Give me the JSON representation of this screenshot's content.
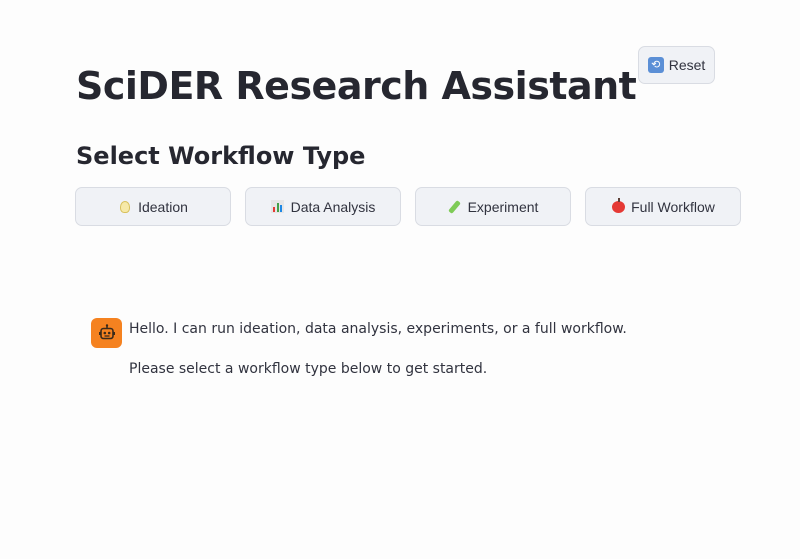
{
  "header": {
    "reset_label": "Reset",
    "reset_icon": "refresh-icon",
    "title": "SciDER Research Assistant"
  },
  "workflow": {
    "section_title": "Select Workflow Type",
    "buttons": [
      {
        "label": "Ideation",
        "icon": "lightbulb-icon"
      },
      {
        "label": "Data Analysis",
        "icon": "bar-chart-icon"
      },
      {
        "label": "Experiment",
        "icon": "test-tube-icon"
      },
      {
        "label": "Full Workflow",
        "icon": "apple-icon"
      }
    ]
  },
  "chat": {
    "avatar_icon": "robot-icon",
    "avatar_color": "#f58220",
    "messages": [
      "Hello. I can run ideation, data analysis, experiments, or a full workflow.",
      "Please select a workflow type below to get started."
    ]
  },
  "colors": {
    "button_bg": "#f0f2f6",
    "title_text": "#262730"
  }
}
